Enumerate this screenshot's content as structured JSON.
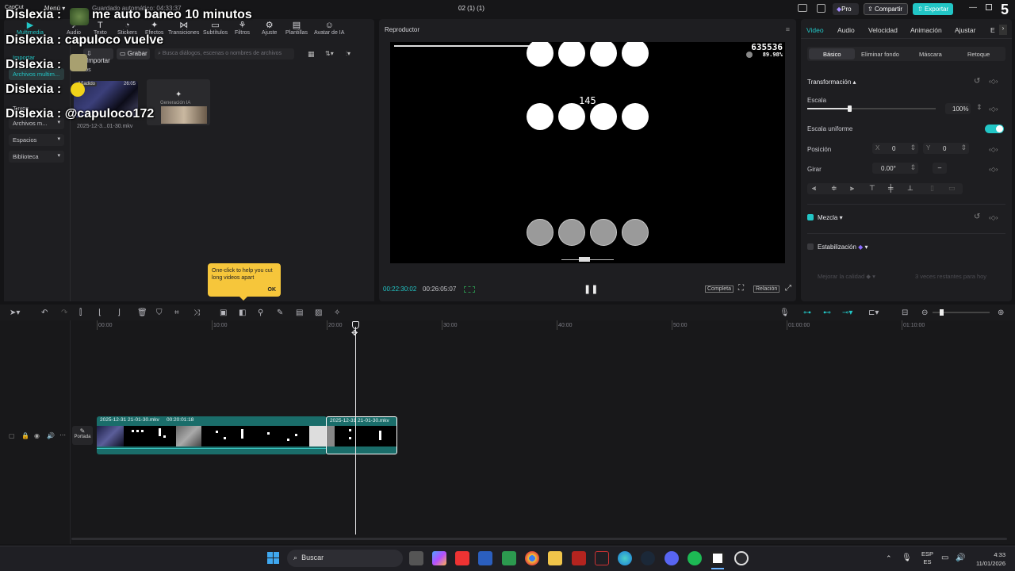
{
  "window": {
    "app_logo": "CapCut",
    "menu_label": "Menú",
    "autosave": "Guardado automático: 04:33:37",
    "project_title": "02 (1) (1)",
    "pro_label": "Pro",
    "share_label": "Compartir",
    "export_label": "Exportar"
  },
  "overlay": {
    "chat": [
      {
        "user": "Dislexia",
        "message": "me auto baneo 10 minutos"
      },
      {
        "user": "Dislexia",
        "message": "capuloco vuelve"
      },
      {
        "user": "Dislexia",
        "message": ""
      },
      {
        "user": "Dislexia",
        "message": ""
      },
      {
        "user": "Dislexia",
        "message": "@capuloco172"
      }
    ],
    "corner_number": "5"
  },
  "toolbox": {
    "items": [
      {
        "label": "Multimedia",
        "icon": "media-icon"
      },
      {
        "label": "Audio",
        "icon": "audio-icon"
      },
      {
        "label": "Texto",
        "icon": "text-icon"
      },
      {
        "label": "Stickers",
        "icon": "sticker-icon"
      },
      {
        "label": "Efectos",
        "icon": "effects-icon"
      },
      {
        "label": "Transiciones",
        "icon": "transition-icon"
      },
      {
        "label": "Subtítulos",
        "icon": "captions-icon"
      },
      {
        "label": "Filtros",
        "icon": "filter-icon"
      },
      {
        "label": "Ajuste",
        "icon": "adjust-icon"
      },
      {
        "label": "Plantillas",
        "icon": "templates-icon"
      },
      {
        "label": "Avatar de IA",
        "icon": "avatar-icon"
      }
    ]
  },
  "media": {
    "sidebar": {
      "import": "Importar",
      "multimedia": "Archivos multim...",
      "yours": "Tuyos",
      "media_files": "Archivos m...",
      "spaces": "Espacios",
      "library": "Biblioteca"
    },
    "import_button": "Importar",
    "record_button": "Grabar",
    "search_placeholder": "Busca diálogos, escenas o nombres de archivos",
    "filter_all": "Todos",
    "clip": {
      "badge": "Añadido",
      "duration": "26:05",
      "name": "2025-12-3...01-30.mkv"
    },
    "ai_generation": "Generación IA",
    "tooltip": {
      "text": "One-click to help you cut long videos apart",
      "ok": "OK"
    }
  },
  "player": {
    "title": "Reproductor",
    "game": {
      "score": "635536",
      "accuracy": "89.98%",
      "combo": "145"
    },
    "current_time": "00:22:30:02",
    "total_time": "00:26:05:07",
    "fit_label": "Completa",
    "ratio_label": "Relación"
  },
  "properties": {
    "tabs": [
      "Video",
      "Audio",
      "Velocidad",
      "Animación",
      "Ajustar",
      "E"
    ],
    "subtabs": [
      "Básico",
      "Eliminar fondo",
      "Máscara",
      "Retoque"
    ],
    "transform_label": "Transformación",
    "scale_label": "Escala",
    "scale_value": "100%",
    "scale_fraction": 0.13,
    "uniform_scale_label": "Escala uniforme",
    "position_label": "Posición",
    "pos_x_label": "X",
    "pos_x": "0",
    "pos_y_label": "Y",
    "pos_y": "0",
    "rotate_label": "Girar",
    "rotate_value": "0.00°",
    "rotate_dash": "–",
    "blend_label": "Mezcla",
    "stabilize_label": "Estabilización",
    "enhance_label": "Mejorar la calidad",
    "enhance_note": "3 veces restantes para hoy",
    "accent": "#21c8c8"
  },
  "timeline": {
    "ruler": [
      "00:00",
      "10:00",
      "20:00",
      "30:00",
      "40:00",
      "50:00",
      "01:00:00",
      "01:10:00"
    ],
    "cover_label": "Portada",
    "clip1": {
      "name": "2025-12-31 21-01-30.mkv",
      "duration": "00:20:01:18"
    },
    "clip2": {
      "name": "2025-12-31 21-01-30.mkv"
    }
  },
  "taskbar": {
    "search": "Buscar",
    "lang_top": "ESP",
    "lang_bottom": "ES",
    "time": "4:33",
    "date": "11/01/2026"
  }
}
